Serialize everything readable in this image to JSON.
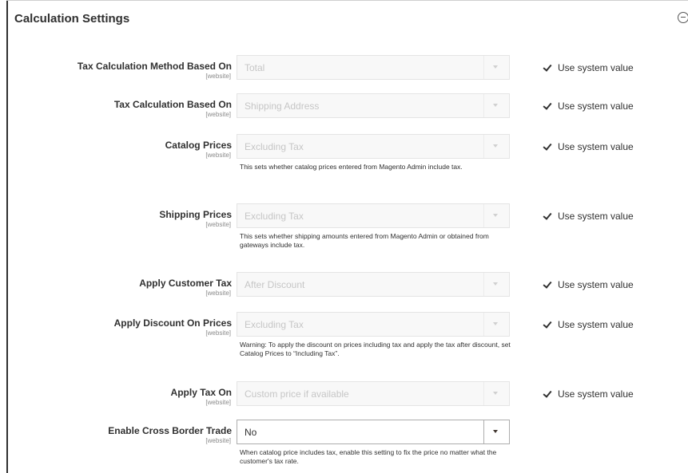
{
  "section": {
    "title": "Calculation Settings"
  },
  "system_value_label": "Use system value",
  "rows": [
    {
      "label": "Tax Calculation Method Based On",
      "scope": "[website]",
      "value": "Total",
      "note": ""
    },
    {
      "label": "Tax Calculation Based On",
      "scope": "[website]",
      "value": "Shipping Address",
      "note": ""
    },
    {
      "label": "Catalog Prices",
      "scope": "[website]",
      "value": "Excluding Tax",
      "note": "This sets whether catalog prices entered from Magento Admin include tax."
    },
    {
      "label": "Shipping Prices",
      "scope": "[website]",
      "value": "Excluding Tax",
      "note": "This sets whether shipping amounts entered from Magento Admin or obtained from gateways include tax."
    },
    {
      "label": "Apply Customer Tax",
      "scope": "[website]",
      "value": "After Discount",
      "note": ""
    },
    {
      "label": "Apply Discount On Prices",
      "scope": "[website]",
      "value": "Excluding Tax",
      "note": "Warning: To apply the discount on prices including tax and apply the tax after discount, set Catalog Prices to “Including Tax”."
    },
    {
      "label": "Apply Tax On",
      "scope": "[website]",
      "value": "Custom price if available",
      "note": ""
    },
    {
      "label": "Enable Cross Border Trade",
      "scope": "[website]",
      "value": "No",
      "note": "When catalog price includes tax, enable this setting to fix the price no matter what the customer's tax rate."
    }
  ]
}
